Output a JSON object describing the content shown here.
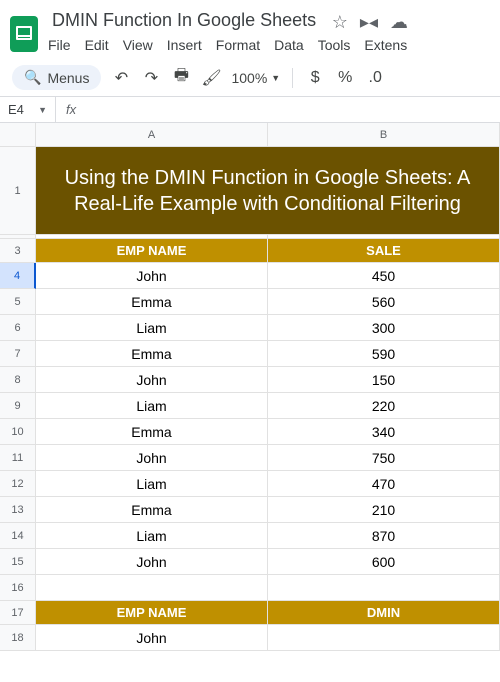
{
  "doc": {
    "title": "DMIN Function In Google Sheets"
  },
  "menus": [
    "File",
    "Edit",
    "View",
    "Insert",
    "Format",
    "Data",
    "Tools",
    "Extens"
  ],
  "toolbar": {
    "search_label": "Menus",
    "zoom": "100%",
    "currency": "$",
    "percent": "%",
    "dec_decrease": ".0"
  },
  "fx": {
    "namebox": "E4",
    "formula": ""
  },
  "columns": [
    "A",
    "B"
  ],
  "row1_title": "Using the DMIN Function in Google Sheets: A Real-Life Example with Conditional Filtering",
  "headers1": {
    "a": "EMP NAME",
    "b": "SALE"
  },
  "data": [
    {
      "n": "4",
      "a": "John",
      "b": "450"
    },
    {
      "n": "5",
      "a": "Emma",
      "b": "560"
    },
    {
      "n": "6",
      "a": "Liam",
      "b": "300"
    },
    {
      "n": "7",
      "a": "Emma",
      "b": "590"
    },
    {
      "n": "8",
      "a": "John",
      "b": "150"
    },
    {
      "n": "9",
      "a": "Liam",
      "b": "220"
    },
    {
      "n": "10",
      "a": "Emma",
      "b": "340"
    },
    {
      "n": "11",
      "a": "John",
      "b": "750"
    },
    {
      "n": "12",
      "a": "Liam",
      "b": "470"
    },
    {
      "n": "13",
      "a": "Emma",
      "b": "210"
    },
    {
      "n": "14",
      "a": "Liam",
      "b": "870"
    },
    {
      "n": "15",
      "a": "John",
      "b": "600"
    }
  ],
  "headers2": {
    "a": "EMP NAME",
    "b": "DMIN"
  },
  "row18": {
    "a": "John",
    "b": ""
  },
  "rownums": {
    "r1": "1",
    "r3": "3",
    "r16": "16",
    "r17": "17",
    "r18": "18"
  }
}
